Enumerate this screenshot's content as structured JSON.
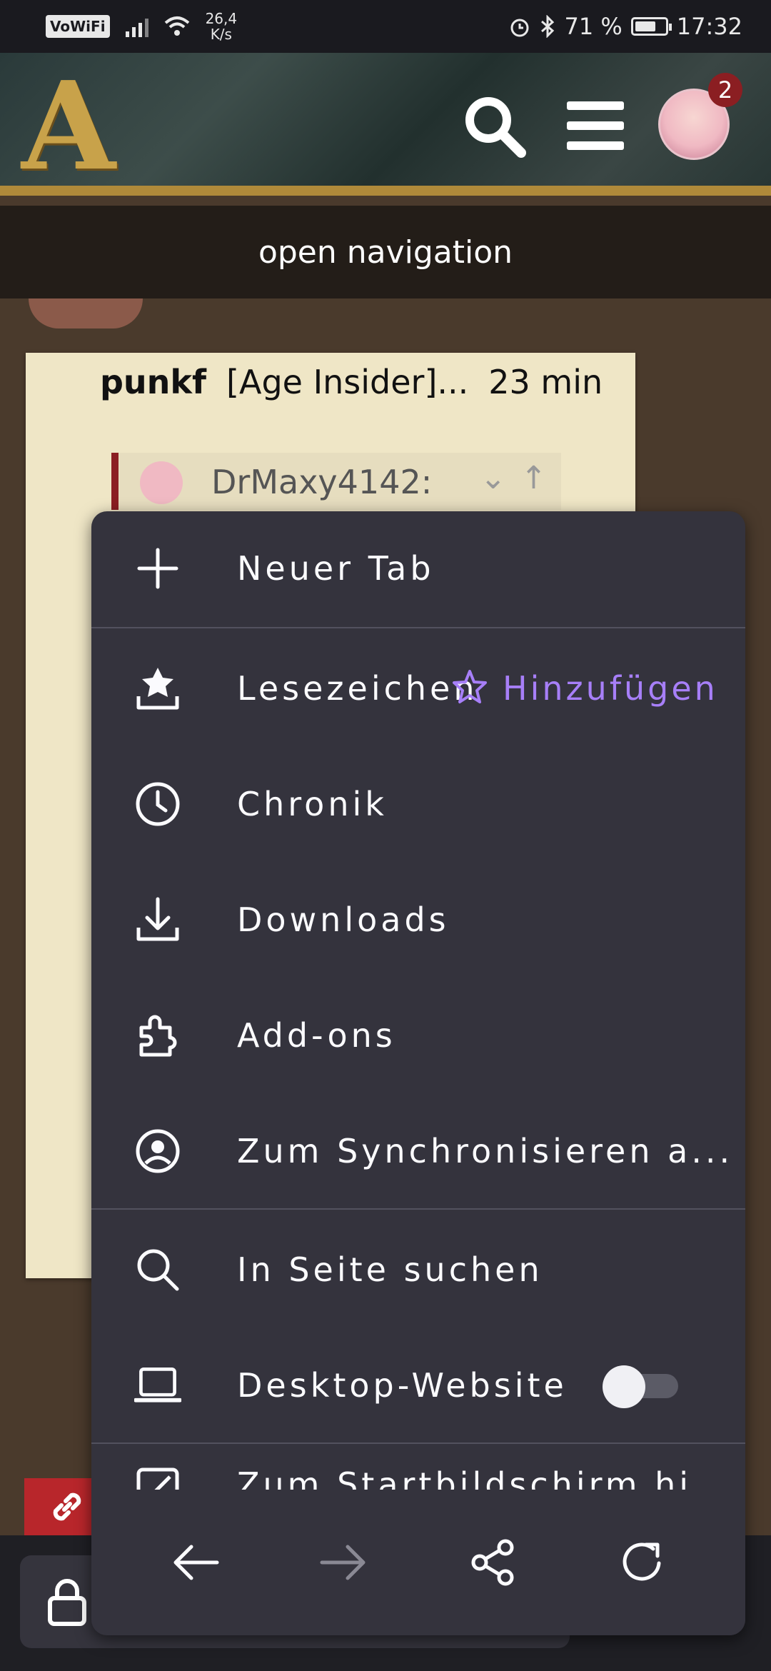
{
  "status_bar": {
    "wifi_label": "VoWiFi",
    "speed_value": "26,4",
    "speed_unit": "K/s",
    "battery_percent": "71 %",
    "battery_level": 0.71,
    "time": "17:32"
  },
  "site_header": {
    "logo_letter": "A",
    "notification_count": "2"
  },
  "nav_bar": {
    "label": "open navigation"
  },
  "post": {
    "username": "punkf",
    "rank": "[Age Insider]...",
    "time_ago": "23 min",
    "quote_user": "DrMaxy4142:"
  },
  "menu": {
    "new_tab": "Neuer Tab",
    "bookmarks": "Lesezeichen",
    "bookmarks_add": "Hinzufügen",
    "history": "Chronik",
    "downloads": "Downloads",
    "addons": "Add-ons",
    "sync": "Zum Synchronisieren a...",
    "find_in_page": "In Seite suchen",
    "desktop_site": "Desktop-Website",
    "desktop_site_enabled": false,
    "add_to_home": "Zum Startbildschirm hi..."
  },
  "colors": {
    "menu_bg": "#34333d",
    "accent_purple": "#a77ff8",
    "header_gold": "#b08a3a",
    "badge_red": "#8b1e22"
  }
}
